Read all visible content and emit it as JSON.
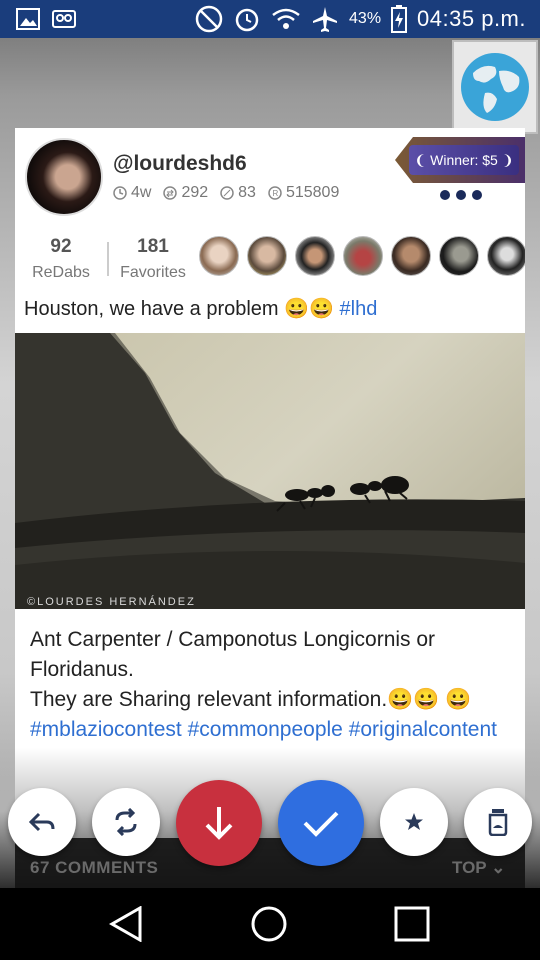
{
  "status_bar": {
    "battery": "43%",
    "time": "04:35 p.m."
  },
  "post": {
    "username": "@lourdeshd6",
    "age": "4w",
    "redabs_count": "292",
    "comments_count_small": "83",
    "views": "515809",
    "winner_label": "Winner: $5",
    "stats": {
      "redabs_value": "92",
      "redabs_label": "ReDabs",
      "favorites_value": "181",
      "favorites_label": "Favorites"
    },
    "caption_text": "Houston, we have a problem 😀😀",
    "caption_tag": "#lhd",
    "photo_credit": "©LOURDES HERNÁNDEZ",
    "description_line1": "Ant Carpenter / Camponotus Longicornis or Floridanus.",
    "description_line2": "They are Sharing relevant information.😀😀 😀",
    "tags": [
      "#mblaziocontest",
      "#commonpeople",
      "#originalcontent"
    ]
  },
  "footer": {
    "comments_label": "67 COMMENTS",
    "top_label": "TOP"
  },
  "actions": [
    "reply-icon",
    "redab-icon",
    "down-arrow-icon",
    "check-icon",
    "star-icon",
    "jar-icon"
  ],
  "colors": {
    "status_bar": "#1a3d7c",
    "accent_blue": "#2f6ee0",
    "accent_red": "#c8303e",
    "hashtag": "#2f6fd1"
  }
}
